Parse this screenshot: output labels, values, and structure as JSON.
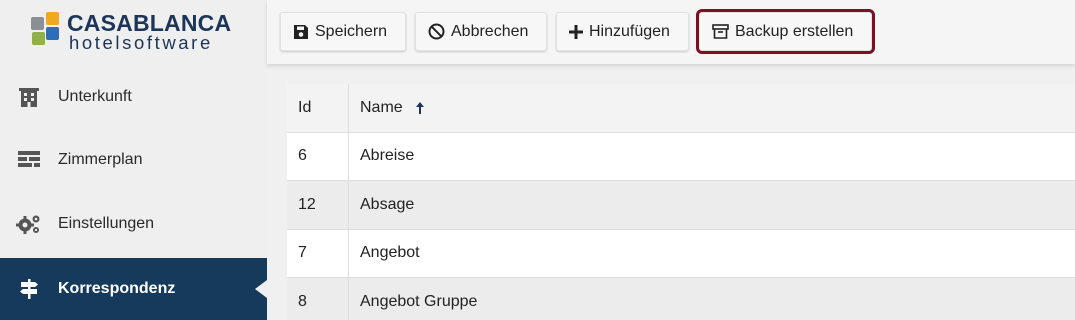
{
  "brand": {
    "name_line1": "CASABLANCA",
    "name_line2": "hotelsoftware",
    "colors": {
      "navy": "#1c3558",
      "orange": "#f0a81c",
      "blue": "#2d6fb7",
      "green": "#8fb04a",
      "gray": "#8a9096"
    }
  },
  "sidebar": {
    "items": [
      {
        "label": "Unterkunft",
        "icon": "building-icon",
        "active": false
      },
      {
        "label": "Zimmerplan",
        "icon": "room-plan-icon",
        "active": false
      },
      {
        "label": "Einstellungen",
        "icon": "gears-icon",
        "active": false
      },
      {
        "label": "Korrespondenz",
        "icon": "signpost-icon",
        "active": true
      }
    ],
    "active_color": "#153a5b"
  },
  "toolbar": {
    "save_label": "Speichern",
    "cancel_label": "Abbrechen",
    "add_label": "Hinzufügen",
    "backup_label": "Backup erstellen",
    "highlight_color": "#7a1024"
  },
  "table": {
    "columns": [
      "Id",
      "Name"
    ],
    "sort": {
      "column": "Name",
      "direction": "asc"
    },
    "rows": [
      {
        "id": "6",
        "name": "Abreise"
      },
      {
        "id": "12",
        "name": "Absage"
      },
      {
        "id": "7",
        "name": "Angebot"
      },
      {
        "id": "8",
        "name": "Angebot Gruppe"
      }
    ]
  }
}
